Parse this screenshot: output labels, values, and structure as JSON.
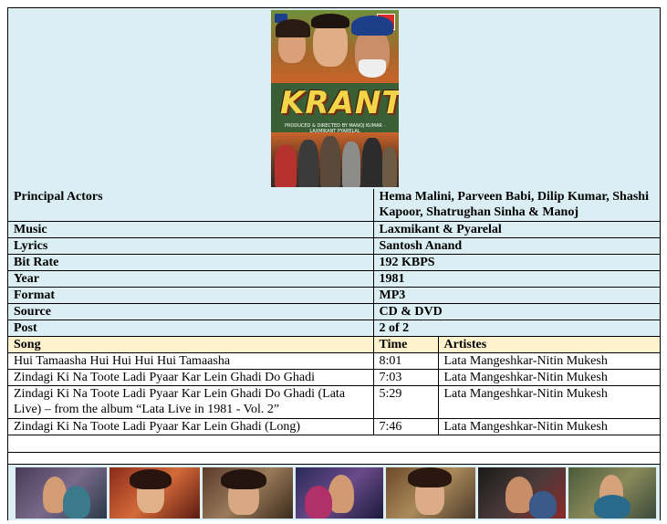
{
  "poster": {
    "title": "KRANTI",
    "credit": "PRODUCED & DIRECTED BY MANOJ KUMAR · LAXMIKANT PYARELAL"
  },
  "details": [
    {
      "key": "Principal Actors",
      "value": "Hema Malini, Parveen Babi, Dilip Kumar, Shashi Kapoor, Shatrughan Sinha & Manoj"
    },
    {
      "key": "Music",
      "value": "Laxmikant & Pyarelal"
    },
    {
      "key": "Lyrics",
      "value": "Santosh Anand"
    },
    {
      "key": "Bit Rate",
      "value": "192 KBPS"
    },
    {
      "key": "Year",
      "value": "1981"
    },
    {
      "key": "Format",
      "value": "MP3"
    },
    {
      "key": "Source",
      "value": "CD & DVD"
    },
    {
      "key": "Post",
      "value": "2 of 2"
    }
  ],
  "song_header": {
    "song": "Song",
    "time": "Time",
    "artistes": "Artistes"
  },
  "songs": [
    {
      "title": "Hui Tamaasha  Hui Hui Hui Hui Tamaasha",
      "time": "8:01",
      "artistes": "Lata Mangeshkar-Nitin Mukesh"
    },
    {
      "title": "Zindagi Ki Na Toote Ladi Pyaar Kar Lein Ghadi Do Ghadi",
      "time": "7:03",
      "artistes": "Lata Mangeshkar-Nitin Mukesh"
    },
    {
      "title": "Zindagi Ki Na Toote Ladi Pyaar Kar Lein Ghadi Do Ghadi (Lata Live) – from the album  “Lata Live in 1981 - Vol. 2”",
      "time": "5:29",
      "artistes": "Lata Mangeshkar-Nitin Mukesh"
    },
    {
      "title": "Zindagi Ki Na Toote Ladi Pyaar Kar Lein Ghadi (Long)",
      "time": "7:46",
      "artistes": "Lata Mangeshkar-Nitin Mukesh"
    }
  ]
}
